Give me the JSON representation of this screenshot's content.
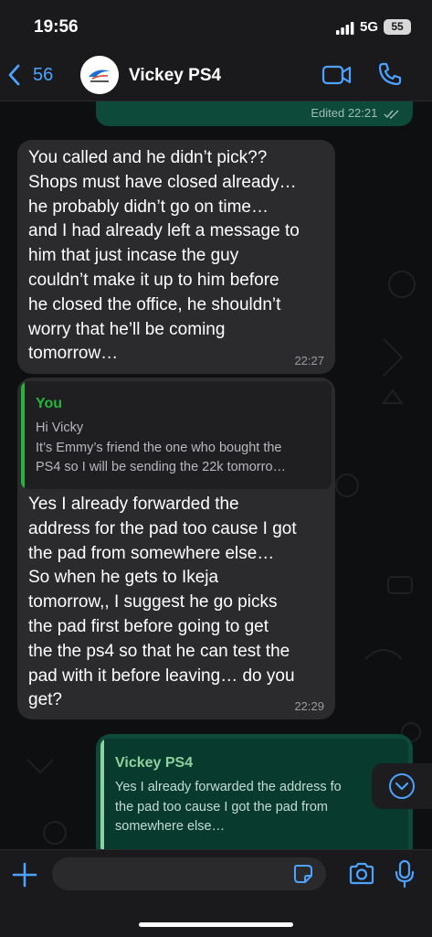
{
  "status_bar": {
    "time": "19:56",
    "network": "5G",
    "battery": "55"
  },
  "header": {
    "back_count": "56",
    "contact_name": "Vickey PS4"
  },
  "messages": {
    "edited_meta": "Edited 22:21",
    "m1": {
      "text": "You called and he didn’t pick??\nShops must have closed already…\nhe probably didn’t go on time…\nand I had already left a message to\nhim that just incase the guy\ncouldn’t make it up to him before\nhe closed the office, he shouldn’t\nworry that he’ll be coming\ntomorrow…",
      "time": "22:27"
    },
    "m2": {
      "quote_author": "You",
      "quote_text": "Hi Vicky\nIt’s Emmy’s friend the one who bought the\nPS4 so I will be sending the 22k tomorro…",
      "text": "Yes I already forwarded the\naddress for the pad too cause I got\nthe pad from somewhere else…\nSo when he gets to Ikeja\ntomorrow,, I suggest he go picks\nthe pad first before going to get\nthe the ps4 so that he can test the\npad with it before leaving… do you\nget?",
      "time": "22:29"
    },
    "m3": {
      "quote_author": "Vickey PS4",
      "quote_text": "Yes I already forwarded the address fo\nthe pad too cause I got the pad from\nsomewhere else…"
    }
  },
  "composer": {
    "placeholder": ""
  },
  "colors": {
    "accent": "#4da3ff",
    "outgoing_bubble": "#0d4a3a",
    "incoming_bubble": "#2b2b2e",
    "quote_you": "#25b53a",
    "quote_contact": "#8fd19e"
  },
  "icons": [
    "back-chevron-icon",
    "video-call-icon",
    "phone-call-icon",
    "read-receipt-icon",
    "chevron-down-icon",
    "plus-icon",
    "sticker-icon",
    "camera-icon",
    "microphone-icon"
  ]
}
